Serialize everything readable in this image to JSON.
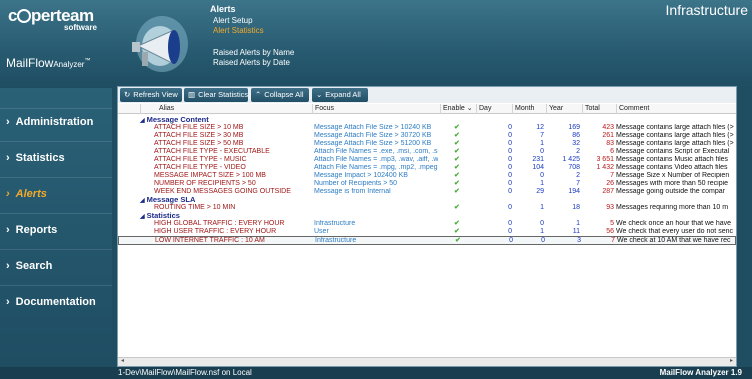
{
  "brand": {
    "logo": "cperteam",
    "logo_sub": "software",
    "product": "MailFlow",
    "product_sub": "Analyzer",
    "product_mark": "™"
  },
  "header": {
    "section_title": "Alerts",
    "menu": [
      "Alert Setup",
      "Alert Statistics"
    ],
    "menu2": [
      "Raised Alerts by Name",
      "Raised Alerts by Date"
    ],
    "active_menu": "Alert Statistics",
    "context": "Infrastructure"
  },
  "nav": [
    {
      "label": "Administration",
      "active": false
    },
    {
      "label": "Statistics",
      "active": false
    },
    {
      "label": "Alerts",
      "active": true
    },
    {
      "label": "Reports",
      "active": false
    },
    {
      "label": "Search",
      "active": false
    },
    {
      "label": "Documentation",
      "active": false
    }
  ],
  "toolbar": {
    "refresh": "Refresh View",
    "clear": "Clear Statistics",
    "collapse": "Collapse All",
    "expand": "Expand All"
  },
  "columns": {
    "alias": "Alias",
    "focus": "Focus",
    "enable": "Enable",
    "day": "Day",
    "month": "Month",
    "year": "Year",
    "total": "Total",
    "comment": "Comment"
  },
  "groups": [
    {
      "name": "Message Content",
      "rows": [
        {
          "alias": "ATTACH FILE SIZE > 10 MB",
          "focus": "Message Attach File Size > 10240 KB",
          "day": "0",
          "month": "12",
          "year": "169",
          "total": "423",
          "comment": "Message contains large attach files (>"
        },
        {
          "alias": "ATTACH FILE SIZE > 30 MB",
          "focus": "Message Attach File Size > 30720 KB",
          "day": "0",
          "month": "7",
          "year": "86",
          "total": "261",
          "comment": "Message contains large attach files (>"
        },
        {
          "alias": "ATTACH FILE SIZE > 50 MB",
          "focus": "Message Attach File Size > 51200 KB",
          "day": "0",
          "month": "1",
          "year": "32",
          "total": "83",
          "comment": "Message contains large attach files (>"
        },
        {
          "alias": "ATTACH FILE TYPE - EXECUTABLE",
          "focus": "Attach File Names = .exe, .msi, .com, .s",
          "day": "0",
          "month": "0",
          "year": "2",
          "total": "6",
          "comment": "Message contains Script or Executal"
        },
        {
          "alias": "ATTACH FILE TYPE - MUSIC",
          "focus": "Attach File Names = .mp3, .wav, .aiff, .w",
          "day": "0",
          "month": "231",
          "year": "1 425",
          "total": "3 651",
          "comment": "Message contains Music attach files"
        },
        {
          "alias": "ATTACH FILE TYPE - VIDEO",
          "focus": "Attach File Names = .mpg, .mp2, .mpeg",
          "day": "0",
          "month": "104",
          "year": "708",
          "total": "1 432",
          "comment": "Message contains Video attach files"
        },
        {
          "alias": "MESSAGE IMPACT SIZE > 100 MB",
          "focus": "Message Impact > 102400 KB",
          "day": "0",
          "month": "0",
          "year": "2",
          "total": "7",
          "comment": "Message Size x Number of Recipien"
        },
        {
          "alias": "NUMBER OF RECIPIENTS > 50",
          "focus": "Number of Recipients > 50",
          "day": "0",
          "month": "1",
          "year": "7",
          "total": "26",
          "comment": "Messages with more than 50 recipie"
        },
        {
          "alias": "WEEK END MESSAGES GOING OUTSIDE",
          "focus": "Message is from Internal",
          "day": "0",
          "month": "29",
          "year": "194",
          "total": "287",
          "comment": "Message going outside the compar"
        }
      ]
    },
    {
      "name": "Message SLA",
      "rows": [
        {
          "alias": "ROUTING TIME > 10 MIN",
          "focus": "",
          "day": "0",
          "month": "1",
          "year": "18",
          "total": "93",
          "comment": "Messages requiring more than 10 m"
        }
      ]
    },
    {
      "name": "Statistics",
      "rows": [
        {
          "alias": "HIGH GLOBAL TRAFFIC : EVERY HOUR",
          "focus": "Infrastructure",
          "day": "0",
          "month": "0",
          "year": "1",
          "total": "5",
          "comment": "We check once an hour that we have"
        },
        {
          "alias": "HIGH USER TRAFFIC : EVERY HOUR",
          "focus": "User",
          "day": "0",
          "month": "1",
          "year": "11",
          "total": "56",
          "comment": "We check that every user do not senc"
        },
        {
          "alias": "LOW INTERNET TRAFFIC : 10 AM",
          "focus": "Infrastructure",
          "day": "0",
          "month": "0",
          "year": "3",
          "total": "7",
          "comment": "We check at 10 AM that we have rec"
        }
      ]
    }
  ],
  "status": {
    "path": "1-Dev\\MailFlow\\MailFlow.nsf on Local",
    "version": "MailFlow Analyzer 1.9"
  }
}
